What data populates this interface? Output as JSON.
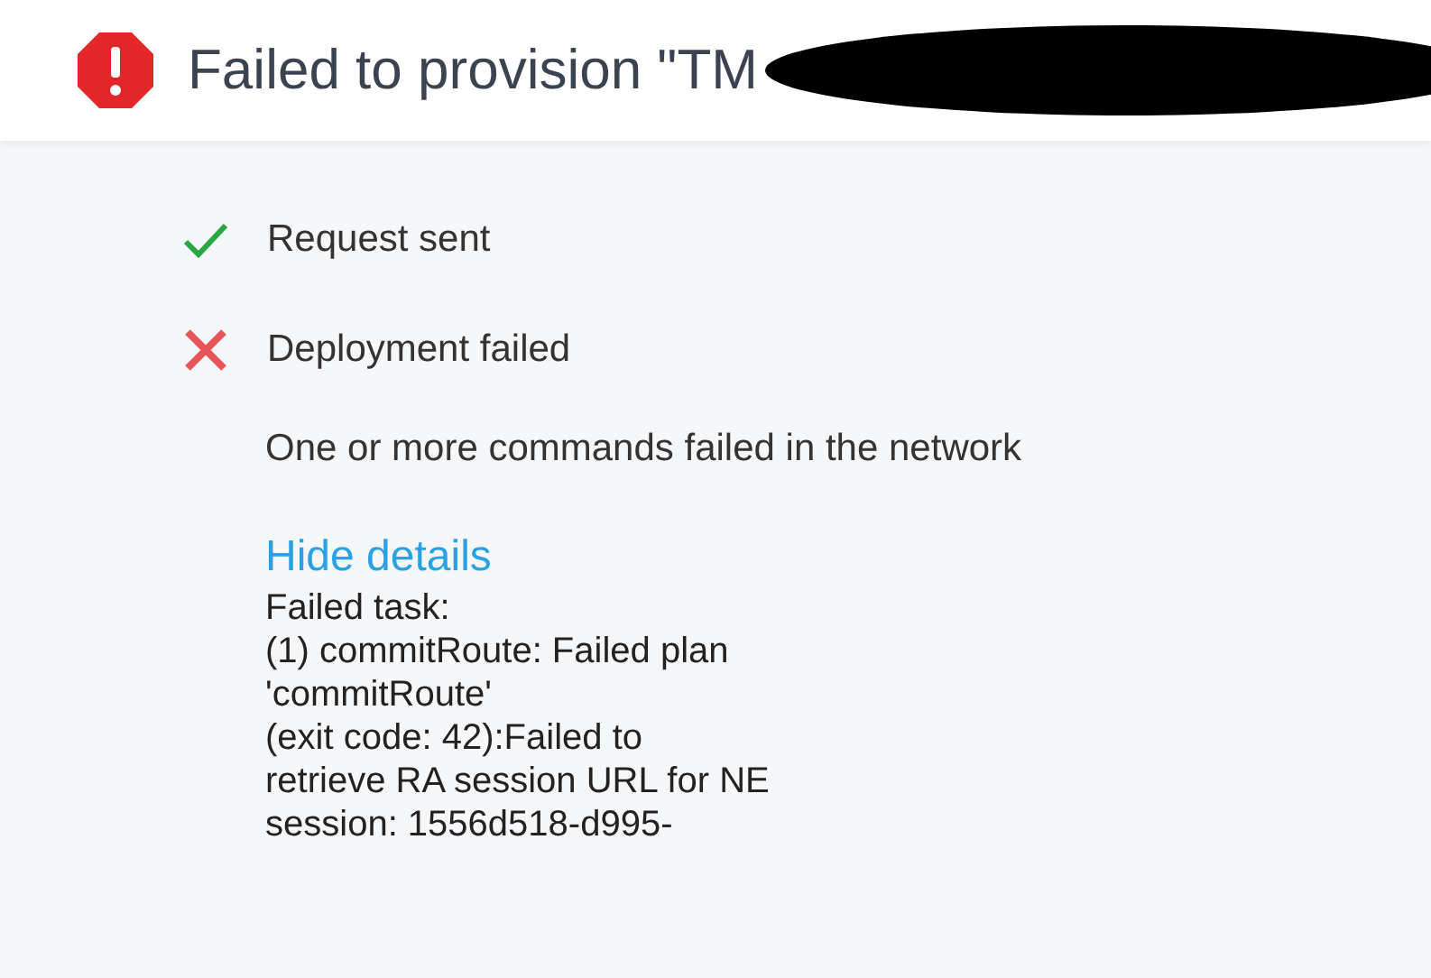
{
  "header": {
    "title": "Failed to provision \"TM",
    "redacted": true
  },
  "steps": [
    {
      "label": "Request sent",
      "kind": "success"
    },
    {
      "label": "Deployment failed",
      "kind": "error"
    }
  ],
  "message": "One or more commands failed in the network",
  "details_link": "Hide details",
  "details_lines": [
    "Failed task:",
    "(1) commitRoute: Failed plan",
    "'commitRoute'",
    "(exit code: 42):Failed to",
    "retrieve RA session URL for NE",
    "session: 1556d518-d995-"
  ]
}
